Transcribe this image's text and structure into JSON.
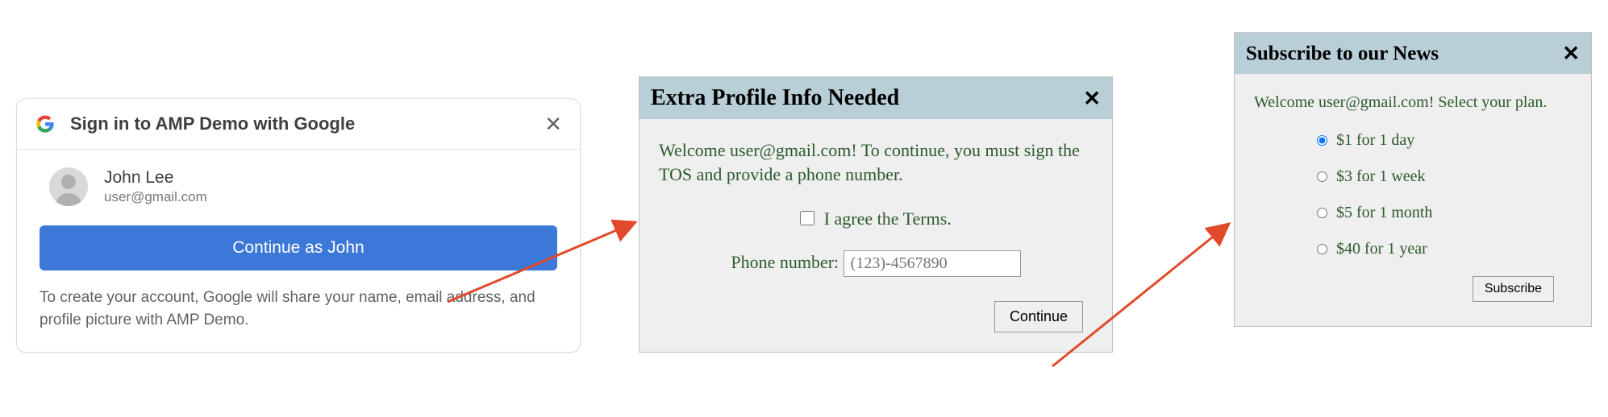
{
  "google_card": {
    "title": "Sign in to AMP Demo with Google",
    "user_name": "John Lee",
    "user_email": "user@gmail.com",
    "continue_label": "Continue as John",
    "disclosure": "To create your account, Google will share your name, email address, and profile picture with AMP Demo."
  },
  "profile_dialog": {
    "title": "Extra Profile Info Needed",
    "body_text": "Welcome user@gmail.com! To continue, you must sign the TOS and provide a phone number.",
    "terms_label": "I agree the Terms.",
    "phone_label": "Phone number: ",
    "phone_placeholder": "(123)-4567890",
    "continue_label": "Continue"
  },
  "subscribe_dialog": {
    "title": "Subscribe to our News",
    "welcome_text": "Welcome user@gmail.com! Select your plan.",
    "plans": [
      {
        "label": "$1 for 1 day",
        "selected": true
      },
      {
        "label": "$3 for 1 week",
        "selected": false
      },
      {
        "label": "$5 for 1 month",
        "selected": false
      },
      {
        "label": "$40 for 1 year",
        "selected": false
      }
    ],
    "subscribe_label": "Subscribe"
  },
  "colors": {
    "dialog_header_bg": "#b9cfd8",
    "dialog_text": "#2c5a2c",
    "google_blue": "#3c78d8",
    "arrow": "#e04a2a"
  }
}
